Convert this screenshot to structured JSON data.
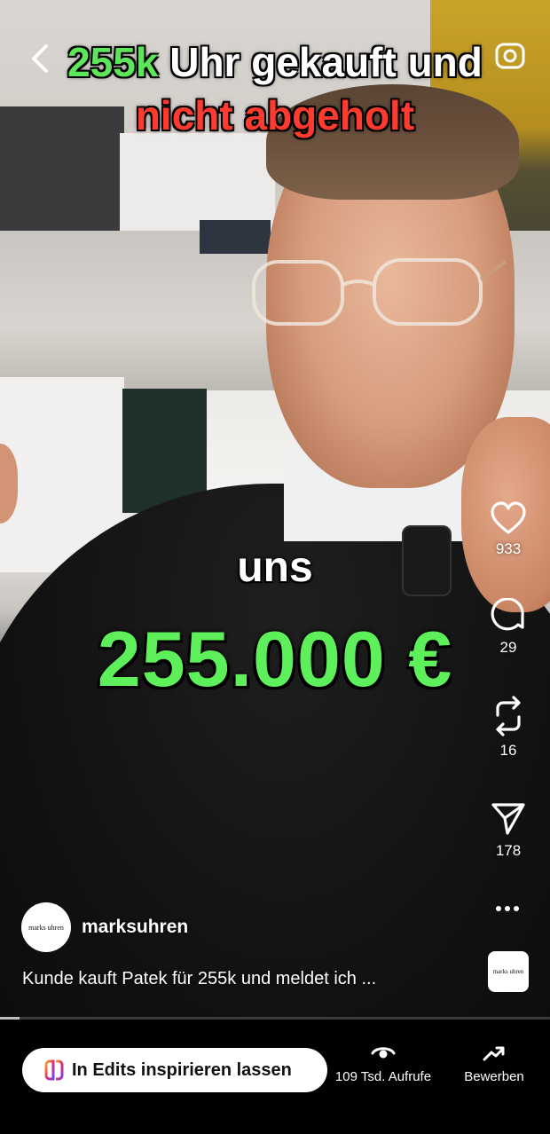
{
  "overlay": {
    "title_highlight": "255k",
    "title_rest": "Uhr gekauft und",
    "title_line2": "nicht abgeholt",
    "caption_small": "uns",
    "caption_big": "255.000 €"
  },
  "actions": {
    "likes": "933",
    "comments": "29",
    "reposts": "16",
    "shares": "178"
  },
  "post": {
    "username": "marksuhren",
    "avatar_text": "marks uhren",
    "description": "Kunde kauft Patek für 255k und meldet ich ...",
    "audio_thumb_text": "marks uhren"
  },
  "playback": {
    "progress_fraction": 0.035
  },
  "bottom_bar": {
    "edits_label": "In Edits inspirieren lassen",
    "views_label": "109 Tsd. Aufrufe",
    "promote_label": "Bewerben"
  },
  "colors": {
    "highlight_green": "#5ef05a",
    "highlight_red": "#ff3b30"
  }
}
